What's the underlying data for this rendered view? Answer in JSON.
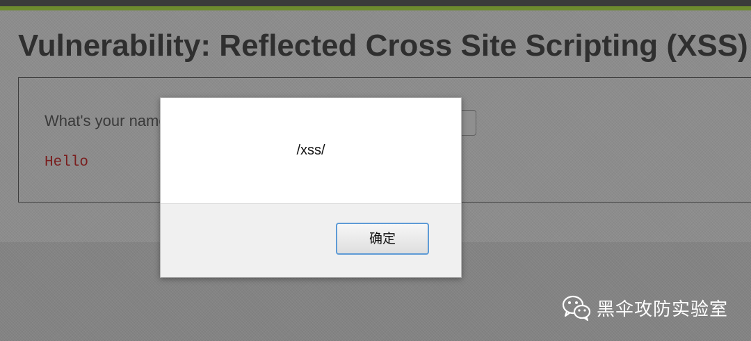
{
  "page": {
    "title": "Vulnerability: Reflected Cross Site Scripting (XSS)",
    "name_prompt": "What's your name?",
    "output_text": "Hello"
  },
  "alert": {
    "message": "/xss/",
    "ok_label": "确定"
  },
  "watermark": {
    "text": "黑伞攻防实验室",
    "icon": "wechat-icon"
  },
  "colors": {
    "accent": "#6d8a2e",
    "topbar": "#3a3a3a",
    "output_text": "#7a1e1e",
    "ok_button_border": "#5e9bd6"
  }
}
